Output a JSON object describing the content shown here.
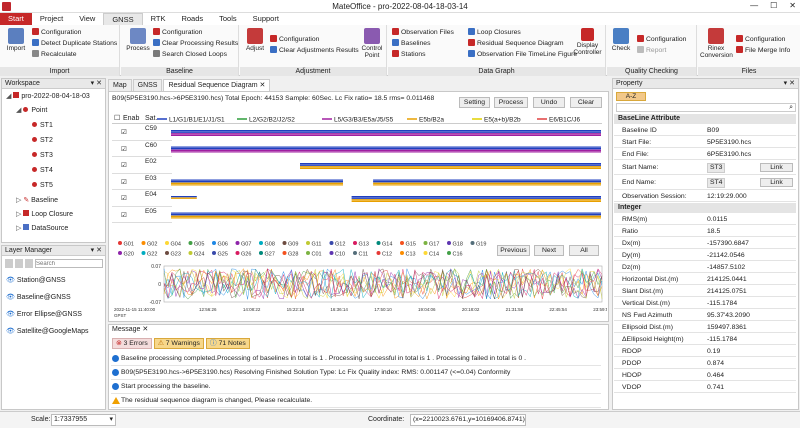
{
  "window": {
    "title": "MateOffice - pro-2022-08-04-18-03-14"
  },
  "menu": [
    "Start",
    "Project",
    "View",
    "GNSS",
    "RTK",
    "Roads",
    "Tools",
    "Support"
  ],
  "ribbon": {
    "import_group": {
      "label": "Import",
      "big": "Import",
      "items": [
        "Configuration",
        "Detect Duplicate Stations",
        "Recalculate"
      ]
    },
    "baseline_group": {
      "label": "Baseline",
      "big": "Process",
      "items": [
        "Configuration",
        "Clear Processing Results",
        "Search Closed Loops"
      ]
    },
    "adjustment_group": {
      "label": "Adjustment",
      "big": "Adjust",
      "big2": "Control Point",
      "items": [
        "Configuration",
        "Clear Adjustments Results"
      ]
    },
    "datagraph_group": {
      "label": "Data Graph",
      "items": [
        "Observation Files",
        "Baselines",
        "Stations",
        "Loop Closures",
        "Residual Sequence Diagram",
        "Observation File TimeLine Figure"
      ],
      "big": "Display Controller"
    },
    "quality_group": {
      "label": "Quality Checking",
      "big": "Check",
      "items": [
        "Configuration",
        "Report"
      ]
    },
    "files_group": {
      "label": "Files",
      "big": "Rinex Conversion",
      "items": [
        "Configuration",
        "File Merge Info"
      ]
    }
  },
  "workspace": {
    "title": "Workspace",
    "project": "pro-2022-08-04-18-03",
    "point_label": "Point",
    "points": [
      "ST1",
      "ST2",
      "ST3",
      "ST4",
      "ST5"
    ],
    "others": [
      "Baseline",
      "Loop Closure",
      "DataSource"
    ]
  },
  "layer_manager": {
    "title": "Layer Manager",
    "search_placeholder": "Search",
    "layers": [
      "Station@GNSS",
      "Baseline@GNSS",
      "Error Ellipse@GNSS",
      "Satellite@GoogleMaps"
    ]
  },
  "tabs": [
    "Map",
    "GNSS",
    "Residual Sequence Diagram"
  ],
  "residual": {
    "info": "B09(5P5E3190.hcs->6P5E3190.hcs)   Total Epoch:  44153   Sample:  60Sec.   Lc Fix   ratio=  18.5   rms=  0.011468",
    "buttons": [
      "Setting",
      "Process",
      "Undo",
      "Clear"
    ],
    "enable_label": "Enab",
    "sat_label": "Sat.",
    "legend": [
      "L1/G1/B1/E1/J1/S1",
      "L2/G2/B2/J2/S2",
      "L5/G3/B3/E5a/J5/S5",
      "E5b/B2a",
      "E5(a+b)/B2b",
      "E6/B1C/J6"
    ],
    "legend_colors": [
      "#1f3fbf",
      "#2e9e3a",
      "#a01fa0",
      "#e8a000",
      "#e0d000",
      "#e04040"
    ],
    "satellites": [
      "C59",
      "C60",
      "E02",
      "E03",
      "E04",
      "E05"
    ],
    "sat_labels_row1": [
      "G01",
      "G02",
      "G04",
      "G05",
      "G06",
      "G07",
      "G08",
      "G09",
      "G11",
      "G12",
      "G13",
      "G14",
      "G15",
      "G17",
      "G18",
      "G19"
    ],
    "sat_labels_row2": [
      "G20",
      "G22",
      "G23",
      "G24",
      "G25",
      "G26",
      "G27",
      "G28",
      "C01",
      "C10",
      "C11",
      "C12",
      "C13",
      "C14",
      "C16"
    ],
    "nav_buttons": [
      "Previous",
      "Next",
      "All"
    ],
    "y_ticks": [
      "0.07",
      "0",
      "-0.07"
    ],
    "x_ticks": [
      "2022-11-15  11:40:00",
      "12:56:26",
      "14:08:22",
      "15:22:18",
      "16:36:14",
      "17:50:10",
      "19:04:06",
      "20:18:02",
      "21:31:58",
      "22:45:54",
      "23:59:50"
    ],
    "gpst_label": "GPST"
  },
  "message": {
    "title": "Message",
    "tabs": [
      "3 Errors",
      "7 Warnings",
      "71 Notes"
    ],
    "rows": [
      {
        "type": "info",
        "text": "Baseline processing completed.Processing of baselines in total is 1 . Processing successful in total is 1 . Processing failed in total is 0 ."
      },
      {
        "type": "info",
        "text": "B09(5P5E3190.hcs->6P5E3190.hcs)   Resolving Finished   Solution Type:      Lc Fix     Quality index:  RMS:   0.001147   (<=0.04)   Conformity"
      },
      {
        "type": "info",
        "text": "Start processing the baseline."
      },
      {
        "type": "warn",
        "text": "The residual sequence diagram is changed, Please recalculate."
      }
    ]
  },
  "property": {
    "title": "Property",
    "sort_label": "A-Z",
    "baseline_section": "BaseLine Attribute",
    "baseline": [
      {
        "k": "Baseline ID",
        "v": "B09"
      },
      {
        "k": "Start File:",
        "v": "5P5E3190.hcs"
      },
      {
        "k": "End File:",
        "v": "6P5E3190.hcs"
      },
      {
        "k": "Start Name:",
        "v": "ST3",
        "link": "Link"
      },
      {
        "k": "End Name:",
        "v": "ST4",
        "link": "Link"
      },
      {
        "k": "Observation Session:",
        "v": "12:19:29.000"
      }
    ],
    "integer_section": "Integer",
    "integer": [
      {
        "k": "RMS(m)",
        "v": "0.0115"
      },
      {
        "k": "Ratio",
        "v": "18.5"
      },
      {
        "k": "Dx(m)",
        "v": "-157390.6847"
      },
      {
        "k": "Dy(m)",
        "v": "-21142.0546"
      },
      {
        "k": "Dz(m)",
        "v": "-14857.5102"
      },
      {
        "k": "Horizontal Dist.(m)",
        "v": "214125.0441"
      },
      {
        "k": "Slant Dist.(m)",
        "v": "214125.0751"
      },
      {
        "k": "Vertical Dist.(m)",
        "v": "-115.1784"
      },
      {
        "k": "NS Fwd Azimuth",
        "v": "95.37'43.2090"
      },
      {
        "k": "Ellipsoid Dist.(m)",
        "v": "159497.8361"
      },
      {
        "k": "ΔEllipsoid Height(m)",
        "v": "-115.1784"
      },
      {
        "k": "RDOP",
        "v": "0.19"
      },
      {
        "k": "PDOP",
        "v": "0.874"
      },
      {
        "k": "HDOP",
        "v": "0.464"
      },
      {
        "k": "VDOP",
        "v": "0.741"
      }
    ]
  },
  "status": {
    "scale_label": "Scale:",
    "scale_value": "1:7337955",
    "coord_label": "Coordinate:",
    "coord_value": "(x=2210023.6761,y=10169406.8741)"
  }
}
